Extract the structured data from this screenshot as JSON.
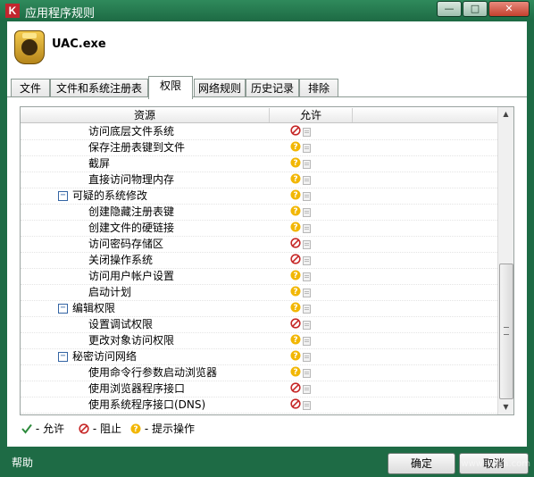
{
  "window": {
    "title": "应用程序规则",
    "app_icon_letter": "K",
    "controls": {
      "minimize": "—",
      "maximize": "□",
      "close": "✕"
    }
  },
  "program": {
    "name": "UAC.exe"
  },
  "tabs": [
    {
      "label": "文件",
      "active": false
    },
    {
      "label": "文件和系统注册表",
      "active": false
    },
    {
      "label": "权限",
      "active": true
    },
    {
      "label": "网络规则",
      "active": false
    },
    {
      "label": "历史记录",
      "active": false
    },
    {
      "label": "排除",
      "active": false
    }
  ],
  "table": {
    "columns": [
      "资源",
      "允许"
    ],
    "rows": [
      {
        "label": "访问底层文件系统",
        "level": 2,
        "permission": "block"
      },
      {
        "label": "保存注册表键到文件",
        "level": 2,
        "permission": "prompt"
      },
      {
        "label": "截屏",
        "level": 2,
        "permission": "prompt"
      },
      {
        "label": "直接访问物理内存",
        "level": 2,
        "permission": "prompt"
      },
      {
        "label": "可疑的系统修改",
        "level": 1,
        "expander": "−",
        "permission": "prompt"
      },
      {
        "label": "创建隐藏注册表键",
        "level": 2,
        "permission": "prompt"
      },
      {
        "label": "创建文件的硬链接",
        "level": 2,
        "permission": "prompt"
      },
      {
        "label": "访问密码存储区",
        "level": 2,
        "permission": "block"
      },
      {
        "label": "关闭操作系统",
        "level": 2,
        "permission": "block"
      },
      {
        "label": "访问用户帐户设置",
        "level": 2,
        "permission": "prompt"
      },
      {
        "label": "启动计划",
        "level": 2,
        "permission": "prompt"
      },
      {
        "label": "编辑权限",
        "level": 1,
        "expander": "−",
        "permission": "prompt"
      },
      {
        "label": "设置调试权限",
        "level": 2,
        "permission": "block"
      },
      {
        "label": "更改对象访问权限",
        "level": 2,
        "permission": "prompt"
      },
      {
        "label": "秘密访问网络",
        "level": 1,
        "expander": "−",
        "permission": "prompt"
      },
      {
        "label": "使用命令行参数启动浏览器",
        "level": 2,
        "permission": "prompt"
      },
      {
        "label": "使用浏览器程序接口",
        "level": 2,
        "permission": "block"
      },
      {
        "label": "使用系统程序接口(DNS)",
        "level": 2,
        "permission": "block"
      }
    ]
  },
  "legend": {
    "allow": "- 允许",
    "block": "- 阻止",
    "prompt": "- 提示操作"
  },
  "footer": {
    "help": "帮助",
    "ok": "确定",
    "cancel": "取消"
  },
  "watermark": {
    "text": "瑞星卡卡",
    "url": "www.ikaka.com"
  },
  "colors": {
    "frame": "#1e6b45",
    "block": "#c62828",
    "prompt": "#f2b705",
    "allow": "#2e8b3d"
  }
}
